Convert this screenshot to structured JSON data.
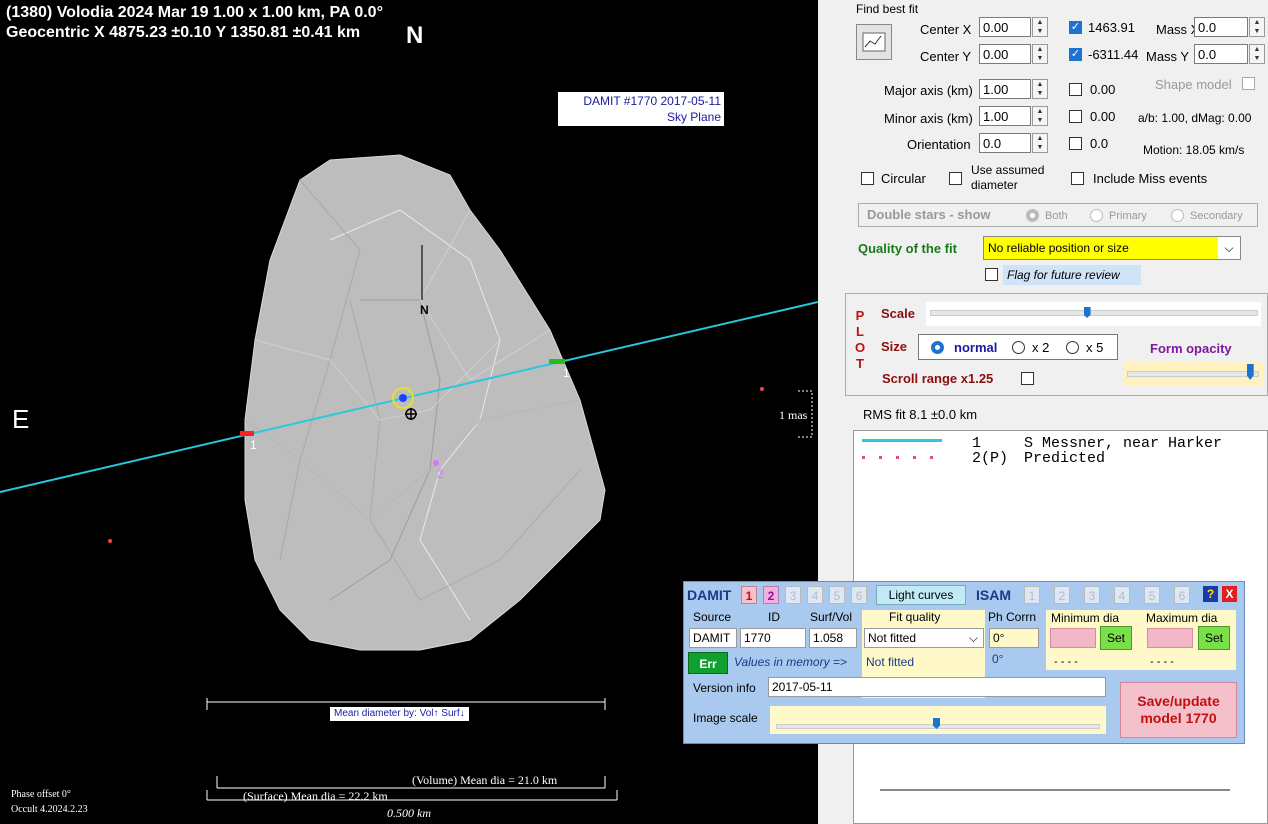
{
  "plot": {
    "header_line1": "(1380) Volodia  2024 Mar 19   1.00 x 1.00 km, PA 0.0°",
    "header_line2": "Geocentric  X  4875.23 ±0.10  Y 1350.81 ±0.41 km",
    "north_big": "N",
    "north_small": "N",
    "east": "E",
    "damit_tag_line1": "DAMIT #1770 2017-05-11",
    "damit_tag_line2": "Sky Plane",
    "chord1_label_left": "1",
    "chord1_label_right": "1",
    "chord2_label": "2",
    "one_mas": "1 mas",
    "mean_dia_by": "Mean diameter by: Vol↑ Surf↓",
    "volume_mean": "(Volume) Mean dia = 21.0 km",
    "surface_mean": "(Surface) Mean dia = 22.2 km",
    "scale_bar": "0.500 km",
    "phase_offset": "Phase offset 0°",
    "version": "Occult 4.2024.2.23",
    "colors": {
      "chord": "#27c8e0",
      "shape": "#bdbdbd",
      "background": "#000000"
    }
  },
  "fit": {
    "find_best_fit": "Find best fit",
    "center_x_label": "Center X",
    "center_x_value": "0.00",
    "center_x_check_value": "1463.91",
    "mass_x_label": "Mass X",
    "mass_x_value": "0.0",
    "center_y_label": "Center Y",
    "center_y_value": "0.00",
    "center_y_check_value": "-6311.44",
    "mass_y_label": "Mass Y",
    "mass_y_value": "0.0",
    "shape_model_label": "Shape model",
    "major_axis_label": "Major axis (km)",
    "major_axis_value": "1.00",
    "major_axis_check_value": "0.00",
    "minor_axis_label": "Minor axis (km)",
    "minor_axis_value": "1.00",
    "minor_axis_check_value": "0.00",
    "ab_dmag": "a/b: 1.00, dMag: 0.00",
    "orientation_label": "Orientation",
    "orientation_value": "0.0",
    "orientation_check_value": "0.0",
    "motion": "Motion: 18.05 km/s",
    "circular_label": "Circular",
    "assumed_diameter_label1": "Use assumed",
    "assumed_diameter_label2": "diameter",
    "include_miss_label": "Include Miss events",
    "double_stars_label": "Double stars - show",
    "double_both": "Both",
    "double_primary": "Primary",
    "double_secondary": "Secondary",
    "quality_label": "Quality of the fit",
    "quality_value": "No reliable position or size",
    "flag_review_label": "Flag for future review"
  },
  "plotctl": {
    "plot_vertical": [
      "P",
      "L",
      "O",
      "T"
    ],
    "scale_label": "Scale",
    "size_label": "Size",
    "size_normal": "normal",
    "size_x2": "x 2",
    "size_x5": "x 5",
    "form_opacity": "Form opacity",
    "scroll_range": "Scroll range x1.25",
    "scale_fraction": 0.48,
    "opacity_fraction": 0.95
  },
  "rms": {
    "label": "RMS fit 8.1 ±0.0 km",
    "legend": [
      {
        "num": "1",
        "name": "S Messner, near Harker",
        "style": "solid"
      },
      {
        "num": "2(P)",
        "name": "Predicted",
        "style": "dotted"
      }
    ]
  },
  "damit": {
    "title": "DAMIT",
    "buttons": [
      "1",
      "2",
      "3",
      "4",
      "5",
      "6"
    ],
    "light_curves": "Light curves",
    "isam": "ISAM",
    "isam_buttons": [
      "1",
      "2",
      "3",
      "4",
      "5",
      "6"
    ],
    "help": "?",
    "close": "X",
    "source_label": "Source",
    "id_label": "ID",
    "surfvol_label": "Surf/Vol",
    "fit_quality_label": "Fit quality",
    "ph_corrn_label": "Ph Corrn",
    "min_dia_label": "Minimum dia",
    "max_dia_label": "Maximum dia",
    "source_value": "DAMIT",
    "id_value": "1770",
    "surfvol_value": "1.058",
    "fit_quality_value": "Not fitted",
    "ph_corrn_value": "0°",
    "set_label": "Set",
    "err_label": "Err",
    "values_in_memory": "Values in memory =>",
    "mem_fit_quality": "Not fitted",
    "mem_ph_corrn": "0°",
    "mem_min": "- - - -",
    "mem_max": "- - - -",
    "version_info_label": "Version info",
    "version_info_value": "2017-05-11",
    "image_scale_label": "Image scale",
    "save_line1": "Save/update",
    "save_line2": "model 1770",
    "image_scale_fraction": 0.5
  }
}
